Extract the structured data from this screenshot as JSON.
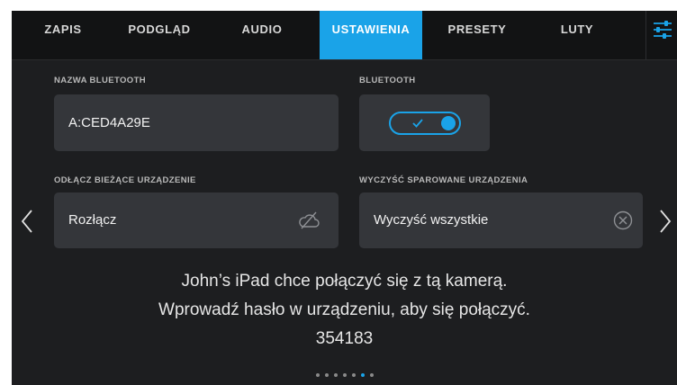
{
  "tabs": [
    {
      "label": "ZAPIS",
      "active": false
    },
    {
      "label": "PODGLĄD",
      "active": false
    },
    {
      "label": "AUDIO",
      "active": false
    },
    {
      "label": "USTAWIENIA",
      "active": true
    },
    {
      "label": "PRESETY",
      "active": false
    },
    {
      "label": "LUTY",
      "active": false
    }
  ],
  "menu_icon": "sliders-icon",
  "bluetooth_name": {
    "label": "NAZWA BLUETOOTH",
    "value": "A:CED4A29E"
  },
  "bluetooth": {
    "label": "BLUETOOTH",
    "enabled": true,
    "toggle_icon": "check-icon"
  },
  "disconnect": {
    "label": "ODŁĄCZ BIEŻĄCE URZĄDZENIE",
    "button_label": "Rozłącz",
    "icon": "disconnected-cloud-icon"
  },
  "clear_paired": {
    "label": "WYCZYŚĆ SPAROWANE URZĄDZENIA",
    "button_label": "Wyczyść wszystkie",
    "icon": "circle-x-icon"
  },
  "navigation": {
    "prev_icon": "chevron-left-icon",
    "next_icon": "chevron-right-icon"
  },
  "pairing_message": {
    "line1": "John’s iPad chce połączyć się z tą kamerą.",
    "line2": "Wprowadź hasło w urządzeniu, aby się połączyć.",
    "code": "354183"
  },
  "pager": {
    "pages": 7,
    "current": 6
  },
  "colors": {
    "accent": "#1aa3e8",
    "panel": "#34363a",
    "background": "#1d1e20",
    "tabbar": "#121314"
  }
}
